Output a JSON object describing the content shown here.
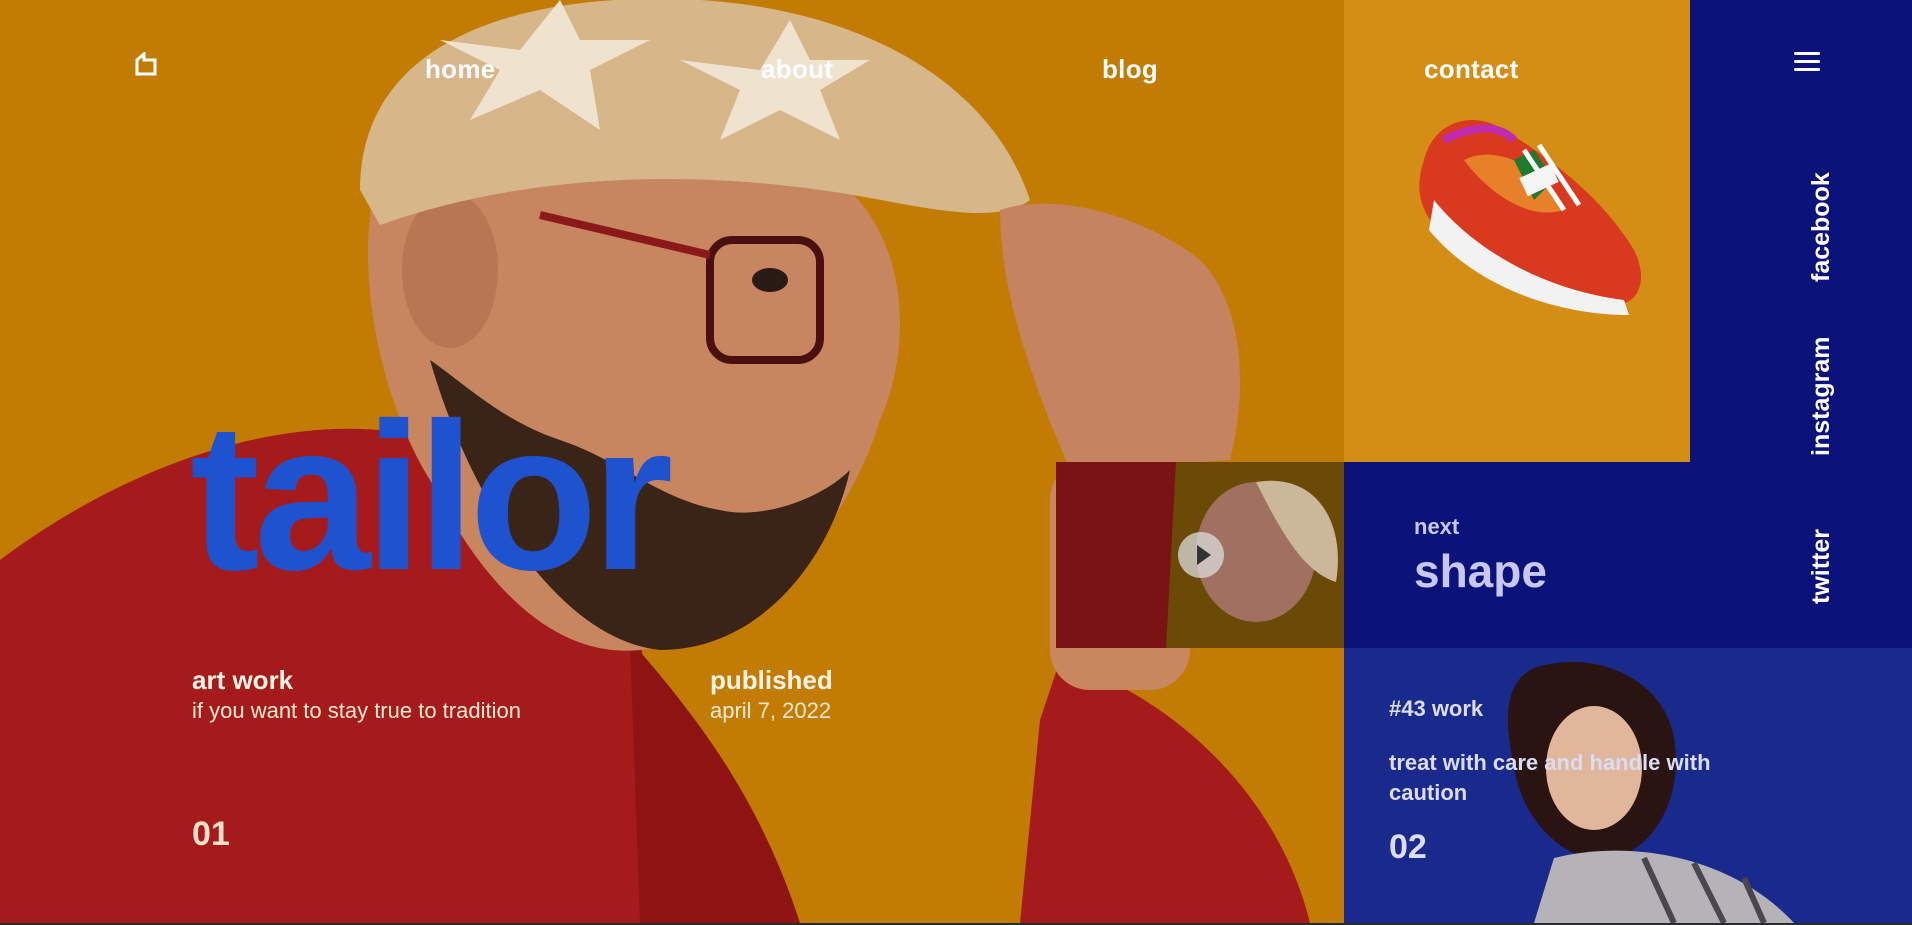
{
  "nav": {
    "logo_icon": "home-logo-icon",
    "links": [
      "home",
      "about",
      "blog",
      "contact"
    ]
  },
  "hero": {
    "title": "tailor",
    "artwork": {
      "heading": "art work",
      "text": "if you want to stay true to tradition"
    },
    "published": {
      "heading": "published",
      "date": "april 7, 2022"
    },
    "number": "01"
  },
  "next": {
    "label": "next",
    "title": "shape"
  },
  "social": [
    "facebook",
    "instagram",
    "twitter"
  ],
  "work": {
    "label": "#43 work",
    "description": "treat with care and handle with caution",
    "number": "02"
  },
  "colors": {
    "hero_bg": "#c27c04",
    "title_blue": "#1f52cf",
    "navy": "#0b137a",
    "work_blue": "#1a2a8c",
    "shoe_bg": "#d48e16"
  }
}
